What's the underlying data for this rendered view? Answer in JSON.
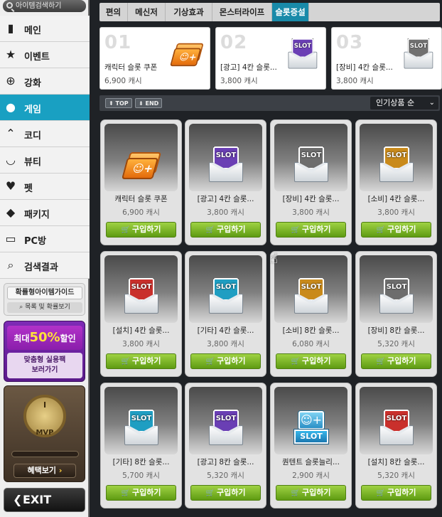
{
  "search": {
    "placeholder": "아이템검색하기",
    "icon": "search-icon"
  },
  "sidebar": {
    "items": [
      {
        "label": "메인",
        "icon": "bookmark-icon",
        "glyph": "▮"
      },
      {
        "label": "이벤트",
        "icon": "star-icon",
        "glyph": "★"
      },
      {
        "label": "강화",
        "icon": "plus-circle-icon",
        "glyph": "⊕"
      },
      {
        "label": "게임",
        "icon": "person-icon",
        "glyph": "●",
        "active": true
      },
      {
        "label": "코디",
        "icon": "hanger-icon",
        "glyph": "⌃"
      },
      {
        "label": "뷰티",
        "icon": "smile-icon",
        "glyph": "◡"
      },
      {
        "label": "펫",
        "icon": "heart-icon",
        "glyph": "♥"
      },
      {
        "label": "패키지",
        "icon": "box-icon",
        "glyph": "◆"
      },
      {
        "label": "PC방",
        "icon": "monitor-icon",
        "glyph": "▭"
      },
      {
        "label": "검색결과",
        "icon": "search-icon",
        "glyph": "⌕"
      }
    ],
    "guide": {
      "title": "확률형아이템가이드",
      "link": "목록 및 확률보기"
    },
    "promo": {
      "prefix": "최대",
      "percent": "50%",
      "suffix": "할인",
      "line1": "맞춤형 실용팩",
      "line2": "보러가기"
    },
    "mvp": {
      "rank": "I",
      "label": "MVP",
      "button": "혜택보기",
      "arrow": "›"
    },
    "exit": {
      "label": "EXIT",
      "arrow": "❮"
    }
  },
  "tabs": [
    {
      "label": "편의",
      "active": false
    },
    {
      "label": "메신저",
      "active": false
    },
    {
      "label": "기상효과",
      "active": false
    },
    {
      "label": "몬스터라이프",
      "active": false
    },
    {
      "label": "슬롯증설",
      "active": true
    }
  ],
  "featured": [
    {
      "num": "01",
      "name": "캐릭터 슬롯 쿠폰",
      "price": "6,900 캐시",
      "icon": "coupon"
    },
    {
      "num": "02",
      "name": "[광고] 4칸 슬롯...",
      "price": "3,800 캐시",
      "icon": "slot",
      "color": "#6a3fb4"
    },
    {
      "num": "03",
      "name": "[장비] 4칸 슬롯...",
      "price": "3,800 캐시",
      "icon": "slot",
      "color": "#707070"
    }
  ],
  "toolbar": {
    "top": "TOP",
    "end": "END",
    "sort": "인기상품 순",
    "sort_icon": "⌄"
  },
  "buy_label": "구입하기",
  "products": [
    {
      "name": "캐릭터 슬롯 쿠폰",
      "price": "6,900 캐시",
      "icon": "coupon"
    },
    {
      "name": "[광고] 4칸 슬롯...",
      "price": "3,800 캐시",
      "icon": "slot",
      "color": "#6a3fb4"
    },
    {
      "name": "[장비] 4칸 슬롯...",
      "price": "3,800 캐시",
      "icon": "slot",
      "color": "#6d6d6d"
    },
    {
      "name": "[소비] 4칸 슬롯...",
      "price": "3,800 캐시",
      "icon": "slot",
      "color": "#c98a1b"
    },
    {
      "name": "[설치] 4칸 슬롯...",
      "price": "3,800 캐시",
      "icon": "slot",
      "color": "#c9302c"
    },
    {
      "name": "[기타] 4칸 슬롯...",
      "price": "3,800 캐시",
      "icon": "slot",
      "color": "#1f9ec2"
    },
    {
      "name": "[소비] 8칸 슬롯...",
      "price": "6,080 캐시",
      "icon": "slot",
      "color": "#c98a1b"
    },
    {
      "name": "[장비] 8칸 슬롯...",
      "price": "5,320 캐시",
      "icon": "slot",
      "color": "#6d6d6d"
    },
    {
      "name": "[기타] 8칸 슬롯...",
      "price": "5,700 캐시",
      "icon": "slot",
      "color": "#1f9ec2"
    },
    {
      "name": "[광고] 8칸 슬롯...",
      "price": "5,320 캐시",
      "icon": "slot",
      "color": "#6a3fb4"
    },
    {
      "name": "퀀텐트 슬롯늘리...",
      "price": "2,900 캐시",
      "icon": "content"
    },
    {
      "name": "[설치] 8칸 슬롯...",
      "price": "5,320 캐시",
      "icon": "slot",
      "color": "#c9302c"
    }
  ],
  "slot_text": "SLOT"
}
